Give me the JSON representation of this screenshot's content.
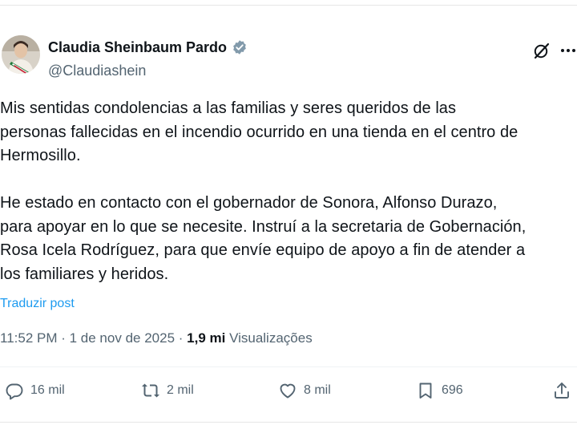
{
  "author": {
    "display_name": "Claudia Sheinbaum Pardo",
    "handle": "@Claudiashein",
    "verified_icon": "verified-badge-icon",
    "badge_color": "#829aab"
  },
  "tweet": {
    "paragraph_1": "Mis sentidas condolencias a las familias y seres queridos de las\npersonas fallecidas en el incendio ocurrido en una tienda en el centro de\nHermosillo.",
    "paragraph_2": "He estado en contacto con el gobernador de Sonora, Alfonso Durazo,\npara apoyar en lo que se necesite. Instruí a la secretaria de Gobernación,\nRosa Icela Rodríguez, para que envíe equipo de apoyo a fin de atender a\nlos familiares y heridos.",
    "translate_link": "Traduzir post"
  },
  "meta": {
    "time": "11:52 PM",
    "separator": " · ",
    "date": "1 de nov de 2025",
    "views_count": "1,9 mi",
    "views_label": " Visualizações"
  },
  "actions": {
    "replies": "16 mil",
    "reposts": "2 mil",
    "likes": "8 mil",
    "bookmarks": "696"
  },
  "colors": {
    "link": "#1d9bf0",
    "secondary_text": "#536471",
    "primary_text": "#0f1419"
  }
}
